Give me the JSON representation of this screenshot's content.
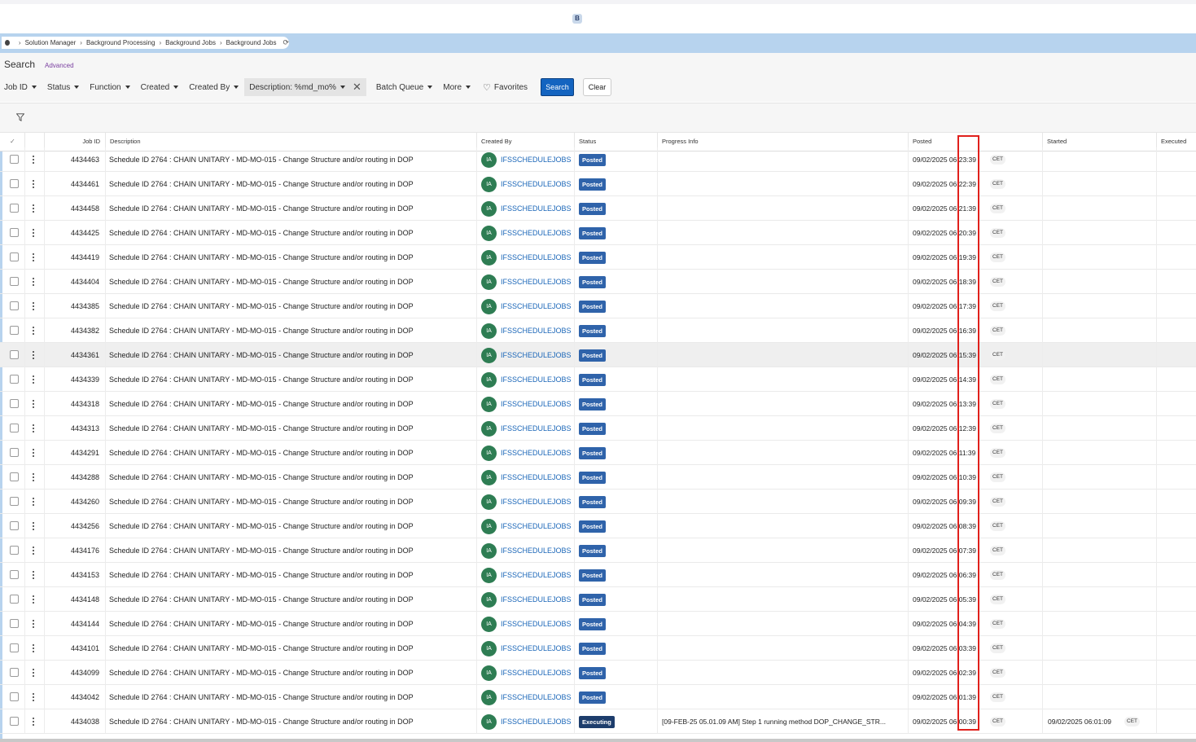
{
  "app": {
    "logo_letter": "B"
  },
  "breadcrumb": {
    "items": [
      "Solution Manager",
      "Background Processing",
      "Background Jobs",
      "Background Jobs"
    ],
    "refresh_icon": "refresh-icon"
  },
  "search": {
    "title": "Search",
    "advanced_label": "Advanced",
    "filters": {
      "job_id": "Job ID",
      "status": "Status",
      "function": "Function",
      "created": "Created",
      "created_by": "Created By",
      "description": "Description: %md_mo%",
      "batch_queue": "Batch Queue",
      "more": "More",
      "favorites": "Favorites"
    },
    "search_button": "Search",
    "clear_button": "Clear"
  },
  "table": {
    "columns": {
      "job_id": "Job ID",
      "description": "Description",
      "created_by": "Created By",
      "status": "Status",
      "progress_info": "Progress Info",
      "posted": "Posted",
      "started": "Started",
      "executed": "Executed"
    },
    "description_text": "Schedule ID 2764 : CHAIN UNITARY - MD-MO-015 - Change Structure and/or routing in DOP",
    "creator_initials": "IA",
    "creator_name": "IFSSCHEDULEJOBS",
    "timezone": "CET",
    "rows": [
      {
        "id": "4434463",
        "status": "Posted",
        "posted": "09/02/2025 06:23:39",
        "progress": "",
        "started": ""
      },
      {
        "id": "4434461",
        "status": "Posted",
        "posted": "09/02/2025 06:22:39",
        "progress": "",
        "started": ""
      },
      {
        "id": "4434458",
        "status": "Posted",
        "posted": "09/02/2025 06:21:39",
        "progress": "",
        "started": ""
      },
      {
        "id": "4434425",
        "status": "Posted",
        "posted": "09/02/2025 06:20:39",
        "progress": "",
        "started": ""
      },
      {
        "id": "4434419",
        "status": "Posted",
        "posted": "09/02/2025 06:19:39",
        "progress": "",
        "started": ""
      },
      {
        "id": "4434404",
        "status": "Posted",
        "posted": "09/02/2025 06:18:39",
        "progress": "",
        "started": ""
      },
      {
        "id": "4434385",
        "status": "Posted",
        "posted": "09/02/2025 06:17:39",
        "progress": "",
        "started": ""
      },
      {
        "id": "4434382",
        "status": "Posted",
        "posted": "09/02/2025 06:16:39",
        "progress": "",
        "started": ""
      },
      {
        "id": "4434361",
        "status": "Posted",
        "posted": "09/02/2025 06:15:39",
        "progress": "",
        "started": "",
        "highlight": true
      },
      {
        "id": "4434339",
        "status": "Posted",
        "posted": "09/02/2025 06:14:39",
        "progress": "",
        "started": ""
      },
      {
        "id": "4434318",
        "status": "Posted",
        "posted": "09/02/2025 06:13:39",
        "progress": "",
        "started": ""
      },
      {
        "id": "4434313",
        "status": "Posted",
        "posted": "09/02/2025 06:12:39",
        "progress": "",
        "started": ""
      },
      {
        "id": "4434291",
        "status": "Posted",
        "posted": "09/02/2025 06:11:39",
        "progress": "",
        "started": ""
      },
      {
        "id": "4434288",
        "status": "Posted",
        "posted": "09/02/2025 06:10:39",
        "progress": "",
        "started": ""
      },
      {
        "id": "4434260",
        "status": "Posted",
        "posted": "09/02/2025 06:09:39",
        "progress": "",
        "started": ""
      },
      {
        "id": "4434256",
        "status": "Posted",
        "posted": "09/02/2025 06:08:39",
        "progress": "",
        "started": ""
      },
      {
        "id": "4434176",
        "status": "Posted",
        "posted": "09/02/2025 06:07:39",
        "progress": "",
        "started": ""
      },
      {
        "id": "4434153",
        "status": "Posted",
        "posted": "09/02/2025 06:06:39",
        "progress": "",
        "started": ""
      },
      {
        "id": "4434148",
        "status": "Posted",
        "posted": "09/02/2025 06:05:39",
        "progress": "",
        "started": ""
      },
      {
        "id": "4434144",
        "status": "Posted",
        "posted": "09/02/2025 06:04:39",
        "progress": "",
        "started": ""
      },
      {
        "id": "4434101",
        "status": "Posted",
        "posted": "09/02/2025 06:03:39",
        "progress": "",
        "started": ""
      },
      {
        "id": "4434099",
        "status": "Posted",
        "posted": "09/02/2025 06:02:39",
        "progress": "",
        "started": ""
      },
      {
        "id": "4434042",
        "status": "Posted",
        "posted": "09/02/2025 06:01:39",
        "progress": "",
        "started": ""
      },
      {
        "id": "4434038",
        "status": "Executing",
        "posted": "09/02/2025 06:00:39",
        "progress": "[09-FEB-25 05.01.09 AM] Step 1 running method DOP_CHANGE_STR...",
        "started": "09/02/2025 06:01:09"
      }
    ]
  },
  "colors": {
    "accent": "#1464c0",
    "status_posted": "#2f63aa",
    "status_executing": "#1d3d6c",
    "avatar": "#2e7d53",
    "link": "#1a66b8",
    "highlight_box": "#e0201c"
  }
}
